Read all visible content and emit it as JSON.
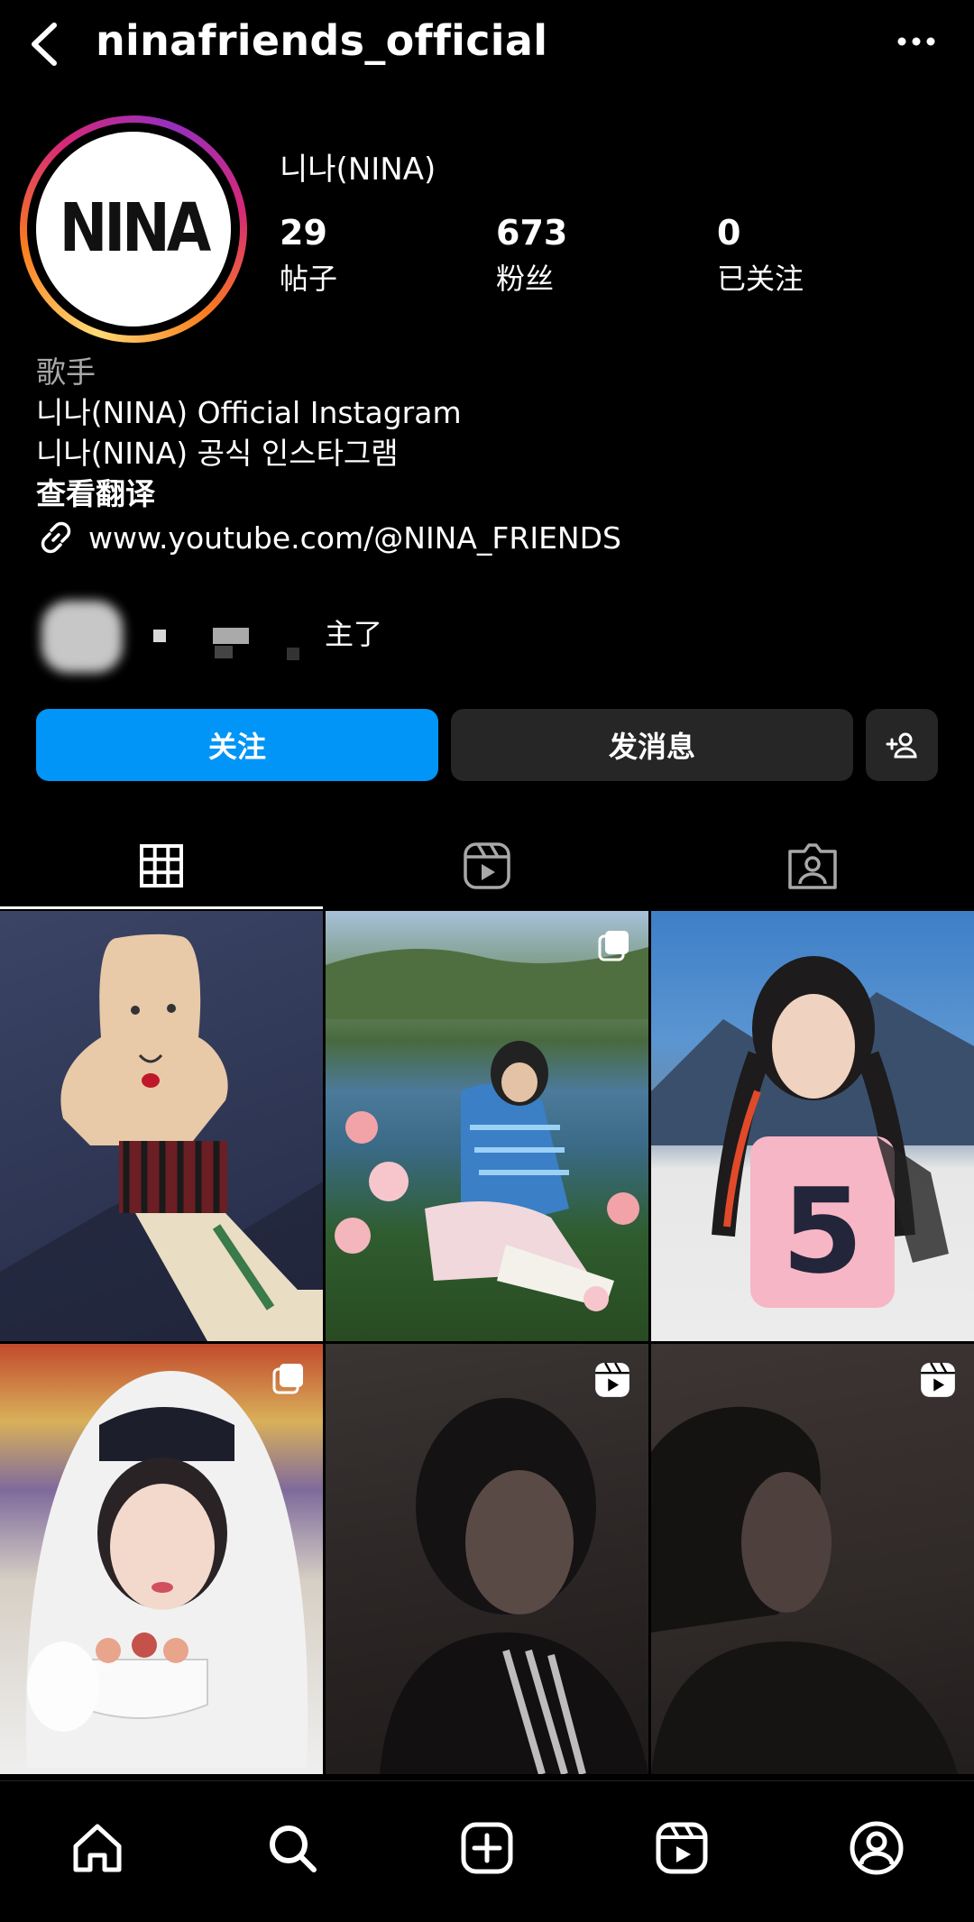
{
  "header": {
    "username": "ninafriends_official",
    "back_icon": "chevron-left-icon",
    "more_icon": "more-dots-icon"
  },
  "profile": {
    "avatar_text": "NINA",
    "display_name": "니나(NINA)",
    "stats": [
      {
        "value": "29",
        "label": "帖子"
      },
      {
        "value": "673",
        "label": "粉丝"
      },
      {
        "value": "0",
        "label": "已关注"
      }
    ],
    "category": "歌手",
    "bio_line1": "니나(NINA) Official Instagram",
    "bio_line2": "니나(NINA) 공식 인스타그램",
    "translate_label": "查看翻译",
    "link": "www.youtube.com/@NINA_FRIENDS",
    "followed_by_suffix": "主了"
  },
  "actions": {
    "follow_label": "关注",
    "message_label": "发消息",
    "add_user_icon": "add-person-icon",
    "follow_color": "#0095f6"
  },
  "tabs": [
    "grid-icon",
    "reels-icon",
    "tagged-icon"
  ],
  "posts": [
    {
      "badge": "none"
    },
    {
      "badge": "carousel-icon"
    },
    {
      "badge": "none"
    },
    {
      "badge": "carousel-icon"
    },
    {
      "badge": "reel-icon"
    },
    {
      "badge": "reel-icon"
    }
  ],
  "bottom_nav": [
    "home-icon",
    "search-icon",
    "create-icon",
    "reels-icon",
    "profile-icon"
  ]
}
